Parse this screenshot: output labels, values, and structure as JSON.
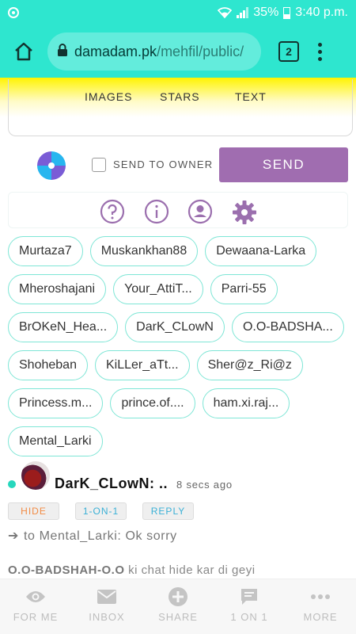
{
  "status_bar": {
    "battery": "35%",
    "time": "3:40 p.m."
  },
  "browser": {
    "url_host": "damadam.pk",
    "url_path": "/mehfil/public/",
    "tab_count": "2"
  },
  "input_tabs": [
    "IMAGES",
    "STARS",
    "TEXT"
  ],
  "send_row": {
    "checkbox_label": "SEND TO OWNER",
    "send_label": "SEND"
  },
  "users": [
    "Murtaza7",
    "Muskankhan88",
    "Dewaana-Larka",
    "Mheroshajani",
    "Your_AttiT...",
    "Parri-55",
    "BrOKeN_Hea...",
    "DarK_CLowN",
    "O.O-BADSHA...",
    "Shoheban",
    "KiLLer_aTt...",
    "Sher@z_Ri@z",
    "Princess.m...",
    "prince.of....",
    "ham.xi.raj...",
    "Mental_Larki"
  ],
  "message": {
    "user": "DarK_CLowN",
    "separator": ": ..",
    "time": "8 secs ago",
    "hide_label": "HIDE",
    "oneone_label": "1-ON-1",
    "reply_label": "REPLY",
    "arrow": "➔",
    "text": "to Mental_Larki: Ok sorry"
  },
  "system_message": {
    "user": "O.O-BADSHAH-O.O",
    "text": " ki chat hide kar di geyi"
  },
  "bottom_nav": [
    {
      "label": "FOR ME",
      "icon": "eye-icon"
    },
    {
      "label": "INBOX",
      "icon": "envelope-icon"
    },
    {
      "label": "SHARE",
      "icon": "plus-circle-icon"
    },
    {
      "label": "1 ON 1",
      "icon": "chat-icon"
    },
    {
      "label": "MORE",
      "icon": "more-icon"
    }
  ],
  "colors": {
    "status_bar": "#2ee6cf",
    "yellow": "#fff300",
    "send_button": "#a06db0",
    "chip_border": "#7fe6d6",
    "icon_purple": "#9b6fae",
    "hide": "#f28b44",
    "link_blue": "#3ab0d6"
  }
}
